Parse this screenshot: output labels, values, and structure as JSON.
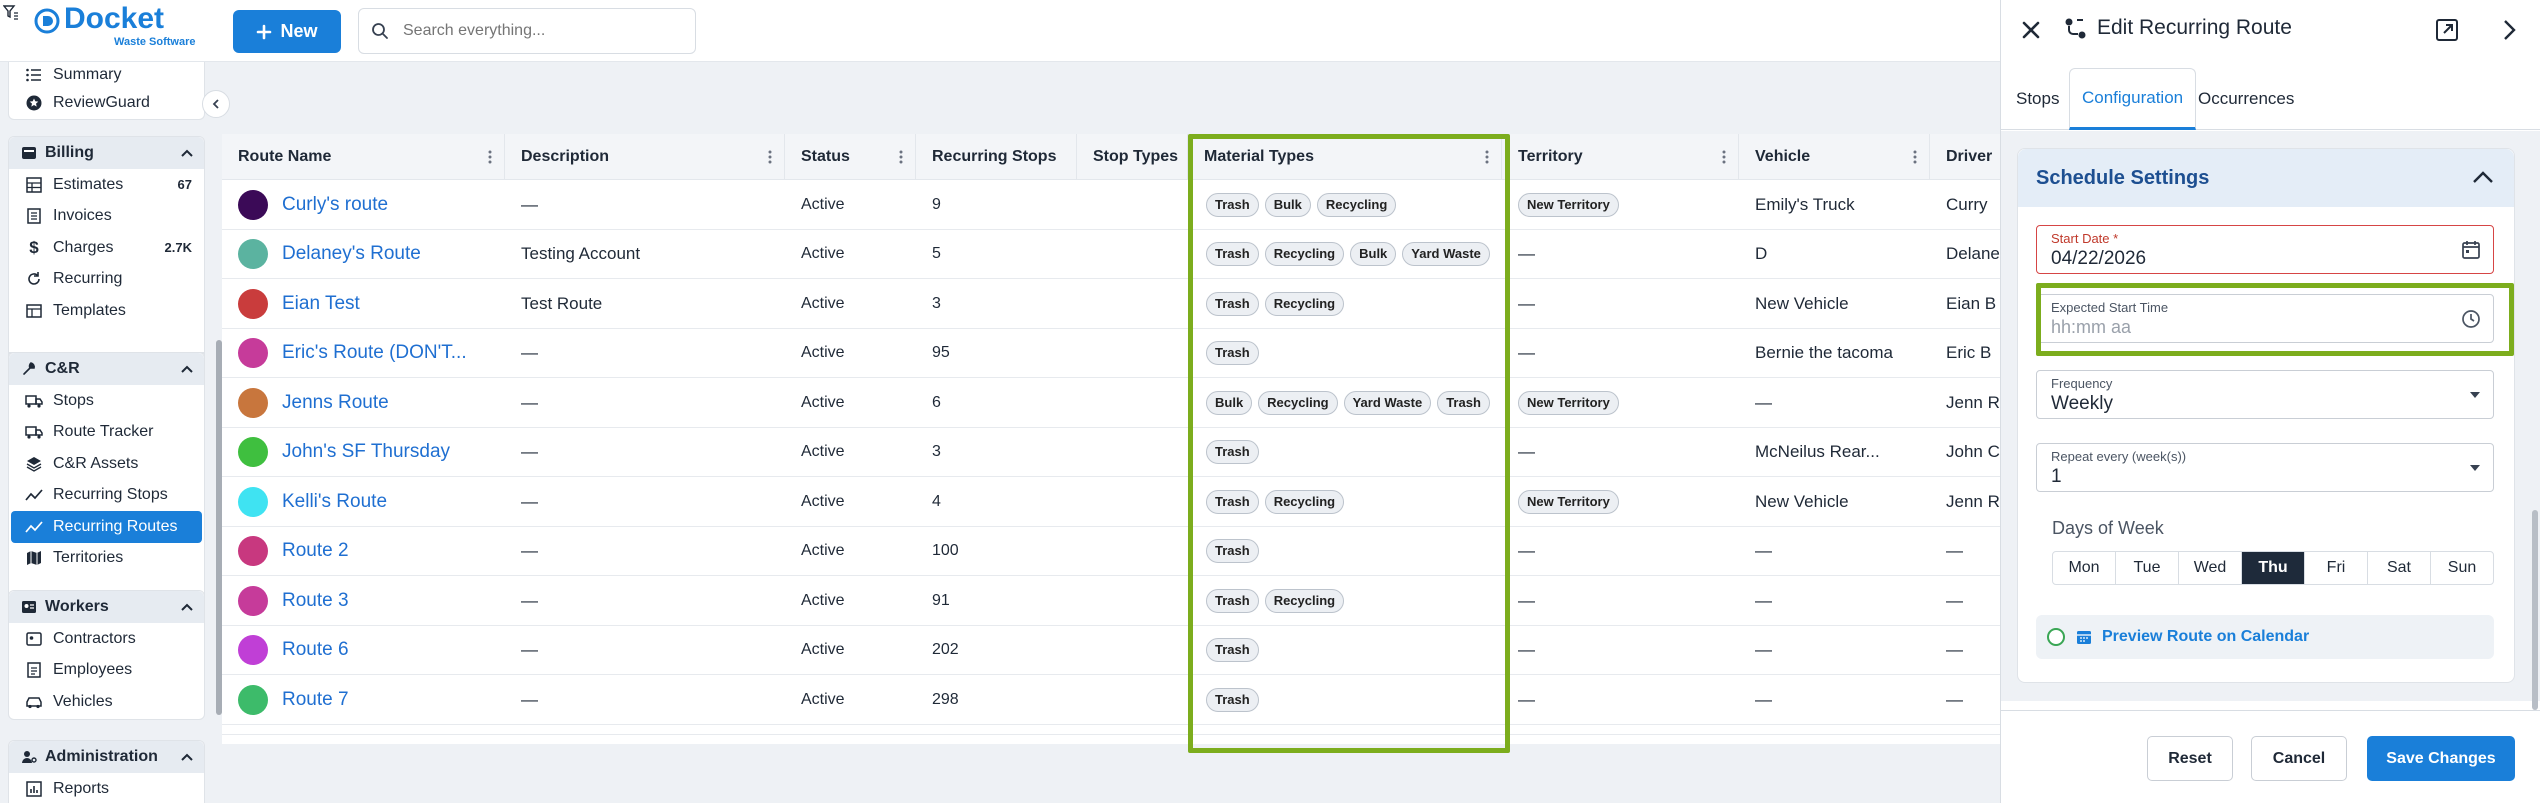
{
  "app": {
    "logo_text": "Docket",
    "logo_subtext": "Waste Software",
    "new_button": "New",
    "search_placeholder": "Search everything..."
  },
  "sidebar": {
    "top_items": [
      {
        "label": "Summary",
        "icon": "list-icon"
      },
      {
        "label": "ReviewGuard",
        "icon": "star-badge-icon"
      }
    ],
    "billing": {
      "title": "Billing",
      "items": [
        {
          "label": "Estimates",
          "count": "67"
        },
        {
          "label": "Invoices",
          "count": ""
        },
        {
          "label": "Charges",
          "count": "2.7K"
        },
        {
          "label": "Recurring",
          "count": ""
        },
        {
          "label": "Templates",
          "count": ""
        }
      ]
    },
    "cr": {
      "title": "C&R",
      "items": [
        {
          "label": "Stops"
        },
        {
          "label": "Route Tracker"
        },
        {
          "label": "C&R Assets"
        },
        {
          "label": "Recurring Stops"
        },
        {
          "label": "Recurring Routes"
        },
        {
          "label": "Territories"
        }
      ]
    },
    "workers": {
      "title": "Workers",
      "items": [
        {
          "label": "Contractors"
        },
        {
          "label": "Employees"
        },
        {
          "label": "Vehicles"
        }
      ]
    },
    "administration": {
      "title": "Administration",
      "items": [
        {
          "label": "Reports"
        }
      ]
    }
  },
  "table": {
    "columns": [
      "Route Name",
      "Description",
      "Status",
      "Recurring Stops",
      "Stop Types",
      "Material Types",
      "Territory",
      "Vehicle",
      "Driver"
    ],
    "rows": [
      {
        "name": "Curly's route",
        "color": "#3b0a57",
        "description": "—",
        "status": "Active",
        "stops": "9",
        "materials": [
          "Trash",
          "Bulk",
          "Recycling"
        ],
        "territory": "New Territory",
        "vehicle": "Emily's Truck",
        "driver": "Curry"
      },
      {
        "name": "Delaney's Route",
        "color": "#5bb3a0",
        "description": "Testing Account",
        "status": "Active",
        "stops": "5",
        "materials": [
          "Trash",
          "Recycling",
          "Bulk",
          "Yard Waste"
        ],
        "territory": "—",
        "vehicle": "D",
        "driver": "Delane"
      },
      {
        "name": "Eian Test",
        "color": "#c93c3c",
        "description": "Test Route",
        "status": "Active",
        "stops": "3",
        "materials": [
          "Trash",
          "Recycling"
        ],
        "territory": "—",
        "vehicle": "New Vehicle",
        "driver": "Eian B"
      },
      {
        "name": "Eric's Route (DON'T...",
        "color": "#c63b9a",
        "description": "—",
        "status": "Active",
        "stops": "95",
        "materials": [
          "Trash"
        ],
        "territory": "—",
        "vehicle": "Bernie the tacoma",
        "driver": "Eric B"
      },
      {
        "name": "Jenns Route",
        "color": "#c8763d",
        "description": "—",
        "status": "Active",
        "stops": "6",
        "materials": [
          "Bulk",
          "Recycling",
          "Yard Waste",
          "Trash"
        ],
        "territory": "New Territory",
        "vehicle": "—",
        "driver": "Jenn R"
      },
      {
        "name": "John's SF Thursday",
        "color": "#3fbf3f",
        "description": "—",
        "status": "Active",
        "stops": "3",
        "materials": [
          "Trash"
        ],
        "territory": "—",
        "vehicle": "McNeilus Rear...",
        "driver": "John C"
      },
      {
        "name": "Kelli's Route",
        "color": "#3fe3f2",
        "description": "—",
        "status": "Active",
        "stops": "4",
        "materials": [
          "Trash",
          "Recycling"
        ],
        "territory": "New Territory",
        "vehicle": "New Vehicle",
        "driver": "Jenn R"
      },
      {
        "name": "Route 2",
        "color": "#c8387f",
        "description": "—",
        "status": "Active",
        "stops": "100",
        "materials": [
          "Trash"
        ],
        "territory": "—",
        "vehicle": "—",
        "driver": "—"
      },
      {
        "name": "Route 3",
        "color": "#c63b9a",
        "description": "—",
        "status": "Active",
        "stops": "91",
        "materials": [
          "Trash",
          "Recycling"
        ],
        "territory": "—",
        "vehicle": "—",
        "driver": "—"
      },
      {
        "name": "Route 6",
        "color": "#c03fd6",
        "description": "—",
        "status": "Active",
        "stops": "202",
        "materials": [
          "Trash"
        ],
        "territory": "—",
        "vehicle": "—",
        "driver": "—"
      },
      {
        "name": "Route 7",
        "color": "#3dbb6a",
        "description": "—",
        "status": "Active",
        "stops": "298",
        "materials": [
          "Trash"
        ],
        "territory": "—",
        "vehicle": "—",
        "driver": "—"
      }
    ]
  },
  "panel": {
    "title": "Edit Recurring Route",
    "tabs": [
      "Stops",
      "Configuration",
      "Occurrences"
    ],
    "active_tab": "Configuration",
    "section_title": "Schedule Settings",
    "start_date_label": "Start Date *",
    "start_date_value": "04/22/2026",
    "start_time_label": "Expected Start Time",
    "start_time_placeholder": "hh:mm aa",
    "frequency_label": "Frequency",
    "frequency_value": "Weekly",
    "repeat_label": "Repeat every (week(s))",
    "repeat_value": "1",
    "dow_label": "Days of Week",
    "days": [
      "Mon",
      "Tue",
      "Wed",
      "Thu",
      "Fri",
      "Sat",
      "Sun"
    ],
    "selected_day": "Thu",
    "preview_link": "Preview Route on Calendar",
    "reset_button": "Reset",
    "cancel_button": "Cancel",
    "save_button": "Save Changes"
  },
  "colors": {
    "accent": "#1a7fd9",
    "highlight": "#7cad1d",
    "error": "#d64545"
  }
}
